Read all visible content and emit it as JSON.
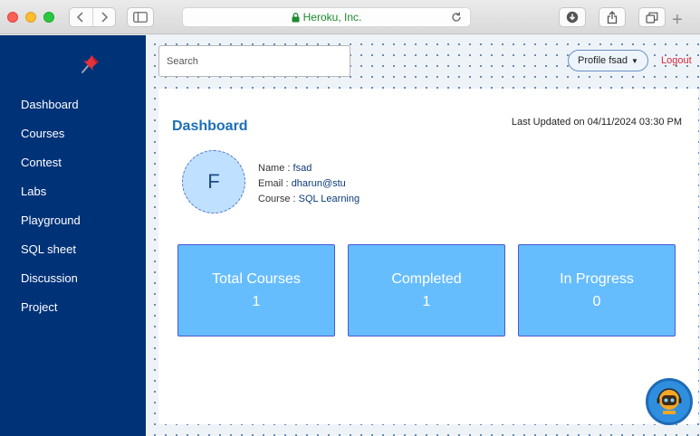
{
  "browser": {
    "url_host": "Heroku, Inc.",
    "tab_icons": [
      "back-icon",
      "forward-icon",
      "sidebar-icon",
      "lock-icon",
      "reload-icon",
      "download-icon",
      "share-icon",
      "tabs-icon",
      "new-tab-icon"
    ],
    "new_tab_label": "+"
  },
  "sidebar": {
    "logo_icon": "pushpin-icon",
    "items": [
      {
        "label": "Dashboard"
      },
      {
        "label": "Courses"
      },
      {
        "label": "Contest"
      },
      {
        "label": "Labs"
      },
      {
        "label": "Playground"
      },
      {
        "label": "SQL sheet"
      },
      {
        "label": "Discussion"
      },
      {
        "label": "Project"
      }
    ],
    "color": "#003278"
  },
  "header": {
    "search_placeholder": "Search",
    "profile_label": "Profile fsad",
    "logout_label": "Logout"
  },
  "dashboard": {
    "title": "Dashboard",
    "last_updated": "Last Updated on 04/11/2024 03:30 PM",
    "avatar_letter": "F",
    "user": {
      "name_label": "Name :",
      "name_value": "fsad",
      "email_label": "Email :",
      "email_value": "dharun@stu",
      "course_label": "Course :",
      "course_value": "SQL Learning"
    },
    "stats": [
      {
        "label": "Total Courses",
        "value": "1"
      },
      {
        "label": "Completed",
        "value": "1"
      },
      {
        "label": "In Progress",
        "value": "0"
      }
    ],
    "accent_color": "#1c6fb8",
    "stat_color": "#66bdfe"
  },
  "assistant": {
    "icon": "chatbot-icon"
  }
}
